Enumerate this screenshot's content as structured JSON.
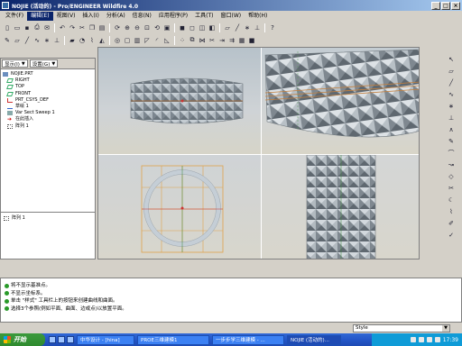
{
  "window": {
    "title": "NOJIE (活动的) - Pro/ENGINEER Wildfire 4.0",
    "min": "_",
    "max": "□",
    "close": "×"
  },
  "menubar": [
    {
      "label": "文件(F)"
    },
    {
      "label": "编辑(E)",
      "active": true
    },
    {
      "label": "视图(V)"
    },
    {
      "label": "插入(I)"
    },
    {
      "label": "分析(A)"
    },
    {
      "label": "信息(N)"
    },
    {
      "label": "应用程序(P)"
    },
    {
      "label": "工具(T)"
    },
    {
      "label": "窗口(W)"
    },
    {
      "label": "帮助(H)"
    }
  ],
  "model_tree": {
    "show_label": "显示(I)",
    "settings_label": "设置(G)",
    "items": [
      {
        "label": "NOJIE.PRT",
        "icon": "part-icon"
      },
      {
        "label": "RIGHT",
        "icon": "datum-plane-icon"
      },
      {
        "label": "TOP",
        "icon": "datum-plane-icon"
      },
      {
        "label": "FRONT",
        "icon": "datum-plane-icon"
      },
      {
        "label": "PRT_CSYS_DEF",
        "icon": "csys-icon"
      },
      {
        "label": "草绘 1",
        "icon": "sketch-icon"
      },
      {
        "label": "Var Sect Sweep 1",
        "icon": "sweep-icon"
      },
      {
        "label": "在此插入",
        "icon": "insert-here-icon"
      },
      {
        "label": "阵列 1",
        "icon": "pattern-icon"
      }
    ],
    "lower_item": "阵列 1"
  },
  "messages": [
    {
      "text": "将不显示基准点。",
      "icon": "info-icon",
      "color": "#1a7f1a"
    },
    {
      "text": "不显示坐标系。",
      "icon": "info-icon",
      "color": "#1a7f1a"
    },
    {
      "text": "单击 \"样式\" 工具栏上的按钮来创建曲线和曲面。",
      "icon": "info-icon",
      "color": "#1a7f1a"
    },
    {
      "text": "选择3个参照(例如平面、曲面、边或点)以放置平面。",
      "icon": "arrow-icon",
      "color": "#1a7f1a"
    }
  ],
  "style_selector": {
    "value": "Style"
  },
  "taskbar": {
    "start": "开始",
    "tasks": [
      {
        "label": "中华设计 - [hina]",
        "active": false
      },
      {
        "label": "PROE三维建模1",
        "active": false
      },
      {
        "label": "一步步学三维建模 - ...",
        "active": false
      },
      {
        "label": "NOJIE (活动的)...",
        "active": true
      }
    ],
    "clock": "17:39"
  }
}
